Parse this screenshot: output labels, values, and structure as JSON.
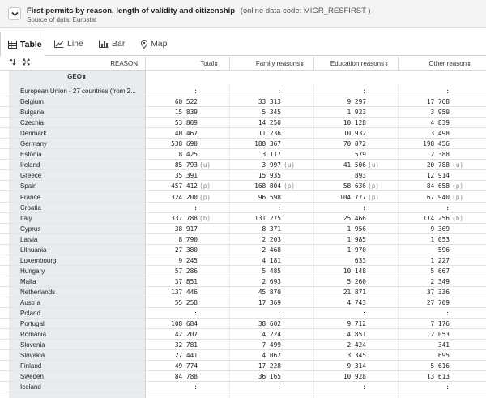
{
  "header": {
    "title": "First permits by reason, length of validity and citizenship",
    "data_code": "(online data code: MIGR_RESFIRST )",
    "source": "Source of data: Eurostat"
  },
  "tabs": [
    {
      "label": "Table",
      "icon": "table-icon",
      "active": true
    },
    {
      "label": "Line",
      "icon": "line-chart-icon",
      "active": false
    },
    {
      "label": "Bar",
      "icon": "bar-chart-icon",
      "active": false
    },
    {
      "label": "Map",
      "icon": "map-pin-icon",
      "active": false
    }
  ],
  "table": {
    "dimension_label": "REASON",
    "geo_label": "GEO",
    "sort_glyph": "⇕",
    "columns": [
      "Total",
      "Family reasons",
      "Education reasons",
      "Other reason"
    ],
    "rows": [
      {
        "geo": "European Union - 27 countries (from 2...",
        "values": [
          ":",
          ":",
          ":",
          ":"
        ],
        "flags": [
          "",
          "",
          "",
          ""
        ]
      },
      {
        "geo": "Belgium",
        "values": [
          "68 522",
          "33 313",
          "9 297",
          "17 768"
        ],
        "flags": [
          "",
          "",
          "",
          ""
        ]
      },
      {
        "geo": "Bulgaria",
        "values": [
          "15 839",
          "5 345",
          "1 923",
          "3 950"
        ],
        "flags": [
          "",
          "",
          "",
          ""
        ]
      },
      {
        "geo": "Czechia",
        "values": [
          "53 809",
          "14 250",
          "10 128",
          "4 839"
        ],
        "flags": [
          "",
          "",
          "",
          ""
        ]
      },
      {
        "geo": "Denmark",
        "values": [
          "40 467",
          "11 236",
          "10 932",
          "3 498"
        ],
        "flags": [
          "",
          "",
          "",
          ""
        ]
      },
      {
        "geo": "Germany",
        "values": [
          "538 690",
          "188 367",
          "70 072",
          "198 456"
        ],
        "flags": [
          "",
          "",
          "",
          ""
        ]
      },
      {
        "geo": "Estonia",
        "values": [
          "8 425",
          "3 117",
          "579",
          "2 388"
        ],
        "flags": [
          "",
          "",
          "",
          ""
        ]
      },
      {
        "geo": "Ireland",
        "values": [
          "85 793",
          "3 997",
          "41 506",
          "20 788"
        ],
        "flags": [
          "(u)",
          "(u)",
          "(u)",
          "(u)"
        ]
      },
      {
        "geo": "Greece",
        "values": [
          "35 391",
          "15 935",
          "893",
          "12 914"
        ],
        "flags": [
          "",
          "",
          "",
          ""
        ]
      },
      {
        "geo": "Spain",
        "values": [
          "457 412",
          "168 804",
          "58 636",
          "84 658"
        ],
        "flags": [
          "(p)",
          "(p)",
          "(p)",
          "(p)"
        ]
      },
      {
        "geo": "France",
        "values": [
          "324 200",
          "96 598",
          "104 777",
          "67 940"
        ],
        "flags": [
          "(p)",
          "",
          "(p)",
          "(p)"
        ]
      },
      {
        "geo": "Croatia",
        "values": [
          ":",
          ":",
          ":",
          ":"
        ],
        "flags": [
          "",
          "",
          "",
          ""
        ]
      },
      {
        "geo": "Italy",
        "values": [
          "337 788",
          "131 275",
          "25 466",
          "114 256"
        ],
        "flags": [
          "(b)",
          "",
          "",
          "(b)"
        ]
      },
      {
        "geo": "Cyprus",
        "values": [
          "38 917",
          "8 371",
          "1 956",
          "9 369"
        ],
        "flags": [
          "",
          "",
          "",
          ""
        ]
      },
      {
        "geo": "Latvia",
        "values": [
          "8 790",
          "2 203",
          "1 985",
          "1 053"
        ],
        "flags": [
          "",
          "",
          "",
          ""
        ]
      },
      {
        "geo": "Lithuania",
        "values": [
          "27 380",
          "2 468",
          "1 970",
          "596"
        ],
        "flags": [
          "",
          "",
          "",
          ""
        ]
      },
      {
        "geo": "Luxembourg",
        "values": [
          "9 245",
          "4 181",
          "633",
          "1 227"
        ],
        "flags": [
          "",
          "",
          "",
          ""
        ]
      },
      {
        "geo": "Hungary",
        "values": [
          "57 286",
          "5 485",
          "10 148",
          "5 667"
        ],
        "flags": [
          "",
          "",
          "",
          ""
        ]
      },
      {
        "geo": "Malta",
        "values": [
          "37 851",
          "2 693",
          "5 260",
          "2 349"
        ],
        "flags": [
          "",
          "",
          "",
          ""
        ]
      },
      {
        "geo": "Netherlands",
        "values": [
          "137 446",
          "45 870",
          "21 871",
          "37 336"
        ],
        "flags": [
          "",
          "",
          "",
          ""
        ]
      },
      {
        "geo": "Austria",
        "values": [
          "55 258",
          "17 369",
          "4 743",
          "27 709"
        ],
        "flags": [
          "",
          "",
          "",
          ""
        ]
      },
      {
        "geo": "Poland",
        "values": [
          ":",
          ":",
          ":",
          ":"
        ],
        "flags": [
          "",
          "",
          "",
          ""
        ]
      },
      {
        "geo": "Portugal",
        "values": [
          "108 684",
          "38 602",
          "9 712",
          "7 176"
        ],
        "flags": [
          "",
          "",
          "",
          ""
        ]
      },
      {
        "geo": "Romania",
        "values": [
          "42 207",
          "4 224",
          "4 851",
          "2 053"
        ],
        "flags": [
          "",
          "",
          "",
          ""
        ]
      },
      {
        "geo": "Slovenia",
        "values": [
          "32 781",
          "7 499",
          "2 424",
          "341"
        ],
        "flags": [
          "",
          "",
          "",
          ""
        ]
      },
      {
        "geo": "Slovakia",
        "values": [
          "27 441",
          "4 062",
          "3 345",
          "695"
        ],
        "flags": [
          "",
          "",
          "",
          ""
        ]
      },
      {
        "geo": "Finland",
        "values": [
          "49 774",
          "17 228",
          "9 314",
          "5 616"
        ],
        "flags": [
          "",
          "",
          "",
          ""
        ]
      },
      {
        "geo": "Sweden",
        "values": [
          "84 788",
          "36 165",
          "10 928",
          "13 613"
        ],
        "flags": [
          "",
          "",
          "",
          ""
        ]
      },
      {
        "geo": "Iceland",
        "values": [
          ":",
          ":",
          ":",
          ":"
        ],
        "flags": [
          "",
          "",
          "",
          ""
        ]
      }
    ]
  }
}
